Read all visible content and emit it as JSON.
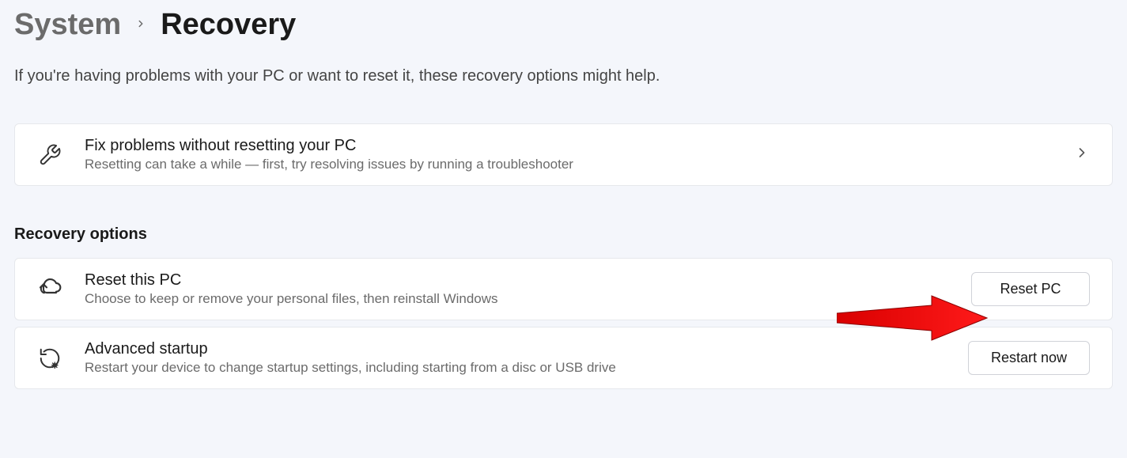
{
  "breadcrumb": {
    "parent": "System",
    "current": "Recovery"
  },
  "description": "If you're having problems with your PC or want to reset it, these recovery options might help.",
  "troubleshoot": {
    "title": "Fix problems without resetting your PC",
    "subtitle": "Resetting can take a while — first, try resolving issues by running a troubleshooter"
  },
  "section_heading": "Recovery options",
  "reset": {
    "title": "Reset this PC",
    "subtitle": "Choose to keep or remove your personal files, then reinstall Windows",
    "button": "Reset PC"
  },
  "advanced": {
    "title": "Advanced startup",
    "subtitle": "Restart your device to change startup settings, including starting from a disc or USB drive",
    "button": "Restart now"
  }
}
